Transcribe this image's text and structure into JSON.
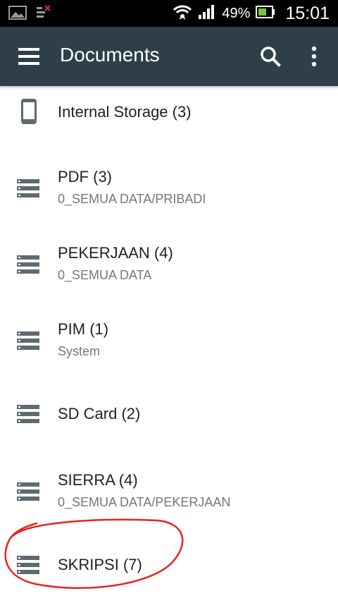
{
  "status_bar": {
    "battery_percent": "49%",
    "time": "15:01",
    "icons": [
      "image-icon",
      "debug-icon",
      "wifi-icon",
      "signal-icon",
      "battery-icon"
    ]
  },
  "app_bar": {
    "title": "Documents",
    "icons": [
      "menu-icon",
      "search-icon",
      "more-vert-icon"
    ],
    "color": "#2f3f4a"
  },
  "roots": [
    {
      "title": "Internal Storage (3)",
      "subtitle": "",
      "icon": "phone-icon"
    },
    {
      "title": "PDF (3)",
      "subtitle": "0_SEMUA DATA/PRIBADI",
      "icon": "storage-icon"
    },
    {
      "title": "PEKERJAAN (4)",
      "subtitle": "0_SEMUA DATA",
      "icon": "storage-icon"
    },
    {
      "title": "PIM (1)",
      "subtitle": "System",
      "icon": "storage-icon"
    },
    {
      "title": "SD Card (2)",
      "subtitle": "",
      "icon": "storage-icon"
    },
    {
      "title": "SIERRA (4)",
      "subtitle": "0_SEMUA DATA/PEKERJAAN",
      "icon": "storage-icon"
    },
    {
      "title": "SKRIPSI (7)",
      "subtitle": "",
      "icon": "storage-icon"
    }
  ],
  "annotation_color": "#e8231e"
}
